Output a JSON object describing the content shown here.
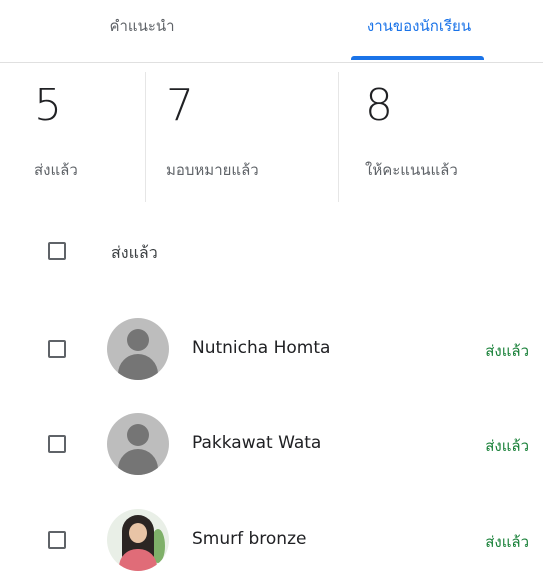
{
  "tabs": [
    {
      "label": "คำแนะนำ",
      "active": false
    },
    {
      "label": "งานของนักเรียน",
      "active": true
    }
  ],
  "stats": [
    {
      "count": "5",
      "label": "ส่งแล้ว"
    },
    {
      "count": "7",
      "label": "มอบหมายแล้ว"
    },
    {
      "count": "8",
      "label": "ให้คะแนนแล้ว"
    }
  ],
  "group": {
    "title": "ส่งแล้ว"
  },
  "students": [
    {
      "name": "Nutnicha Homta",
      "status": "ส่งแล้ว",
      "avatar": "default-avatar-icon"
    },
    {
      "name": "Pakkawat Wata",
      "status": "ส่งแล้ว",
      "avatar": "default-avatar-icon"
    },
    {
      "name": "Smurf bronze",
      "status": "ส่งแล้ว",
      "avatar": "profile-photo"
    }
  ],
  "colors": {
    "accent": "#1a73e8",
    "status_green": "#188038",
    "text": "#202124",
    "secondary": "#5f6368"
  }
}
